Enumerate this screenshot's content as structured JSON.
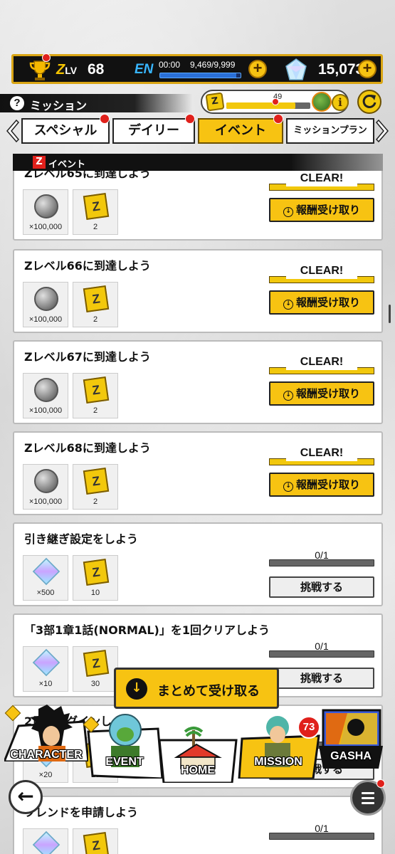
{
  "topbar": {
    "zlv_label_z": "Z",
    "zlv_label_lv": "LV",
    "level": "68",
    "en_label": "EN",
    "en_time": "00:00",
    "en_value": "9,469/9,999",
    "en_fill_fraction": 0.947,
    "plus": "+",
    "gems": "15,073"
  },
  "header": {
    "help": "?",
    "title": "ミッション",
    "pass_ticket": "Z",
    "pass_count": "49",
    "pass_fill_fraction": 0.82,
    "info": "i"
  },
  "tabs": [
    {
      "label": "スペシャル"
    },
    {
      "label": "デイリー"
    },
    {
      "label": "イベント"
    },
    {
      "label": "ミッションプラン"
    }
  ],
  "section": {
    "badge": "Z",
    "label": "イベント"
  },
  "missions": [
    {
      "title": "Zレベル65に到達しよう",
      "r1_type": "coin",
      "r1_qty": "×100,000",
      "r2_type": "ticket",
      "r2_qty": "2",
      "status": "CLEAR!",
      "button": "報酬受け取り"
    },
    {
      "title": "Zレベル66に到達しよう",
      "r1_type": "coin",
      "r1_qty": "×100,000",
      "r2_type": "ticket",
      "r2_qty": "2",
      "status": "CLEAR!",
      "button": "報酬受け取り"
    },
    {
      "title": "Zレベル67に到達しよう",
      "r1_type": "coin",
      "r1_qty": "×100,000",
      "r2_type": "ticket",
      "r2_qty": "2",
      "status": "CLEAR!",
      "button": "報酬受け取り"
    },
    {
      "title": "Zレベル68に到達しよう",
      "r1_type": "coin",
      "r1_qty": "×100,000",
      "r2_type": "ticket",
      "r2_qty": "2",
      "status": "CLEAR!",
      "button": "報酬受け取り"
    },
    {
      "title": "引き継ぎ設定をしよう",
      "r1_type": "crystal",
      "r1_qty": "×500",
      "r2_type": "ticket",
      "r2_qty": "10",
      "progress": "0/1",
      "button": "挑戦する"
    },
    {
      "title": "「3部1章1話(NORMAL)」を1回クリアしよう",
      "r1_type": "crystal",
      "r1_qty": "×10",
      "r2_type": "ticket",
      "r2_qty": "30",
      "progress": "0/1",
      "button": "挑戦する"
    },
    {
      "title": "2日間ログインしよう",
      "r1_type": "crystal",
      "r1_qty": "×20",
      "r2_type": "ticket",
      "r2_qty": "10",
      "progress": "",
      "button": "挑戦する"
    },
    {
      "title": "フレンドを申請しよう",
      "r1_type": "crystal",
      "r1_qty": "",
      "r2_type": "ticket",
      "r2_qty": "",
      "progress": "0/1",
      "button": ""
    }
  ],
  "collect_all": {
    "icon": "↓",
    "label": "まとめて受け取る"
  },
  "nav": {
    "character": "CHARACTER",
    "event": "EVENT",
    "home": "HOME",
    "mission": "MISSION",
    "mission_badge": "73",
    "gasha": "GASHA"
  },
  "back_icon": "←",
  "colors": {
    "accent": "#f7c312",
    "badge": "#e0201b",
    "energy": "#2a70d8"
  }
}
